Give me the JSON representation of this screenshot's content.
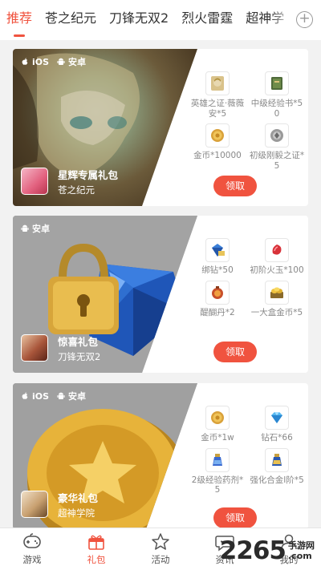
{
  "tabs": [
    {
      "label": "推荐",
      "active": true
    },
    {
      "label": "苍之纪元",
      "active": false
    },
    {
      "label": "刀锋无双2",
      "active": false
    },
    {
      "label": "烈火雷霆",
      "active": false
    },
    {
      "label": "超神学",
      "active": false
    }
  ],
  "tab_add_icon": "plus-circle-icon",
  "platform_labels": {
    "ios": "iOS",
    "android": "安卓"
  },
  "cards": [
    {
      "platforms": [
        "ios",
        "android"
      ],
      "pack_name": "星辉专属礼包",
      "game_name": "苍之纪元",
      "items": [
        {
          "icon": "hero-certificate-icon",
          "label": "英雄之证·薇薇安*5"
        },
        {
          "icon": "exp-book-icon",
          "label": "中级经验书*50"
        },
        {
          "icon": "gold-coin-icon",
          "label": "金币*10000"
        },
        {
          "icon": "forge-cert-icon",
          "label": "初级刚毅之证*5"
        }
      ],
      "claim_label": "领取"
    },
    {
      "platforms": [
        "android"
      ],
      "pack_name": "惊喜礼包",
      "game_name": "刀锋无双2",
      "items": [
        {
          "icon": "bound-diamond-icon",
          "label": "绑钻*50"
        },
        {
          "icon": "fire-jade-icon",
          "label": "初阶火玉*100"
        },
        {
          "icon": "elixir-icon",
          "label": "醍醐丹*2"
        },
        {
          "icon": "gold-box-icon",
          "label": "一大盒金币*5"
        }
      ],
      "claim_label": "领取"
    },
    {
      "platforms": [
        "ios",
        "android"
      ],
      "pack_name": "豪华礼包",
      "game_name": "超神学院",
      "items": [
        {
          "icon": "gold-coin-icon",
          "label": "金币*1w"
        },
        {
          "icon": "diamond-icon",
          "label": "钻石*66"
        },
        {
          "icon": "exp-potion-icon",
          "label": "2级经验药剂*5"
        },
        {
          "icon": "alloy-icon",
          "label": "强化合金I阶*5"
        }
      ],
      "claim_label": "领取"
    }
  ],
  "bottom_nav": [
    {
      "icon": "gamepad-icon",
      "label": "游戏",
      "active": false
    },
    {
      "icon": "gift-icon",
      "label": "礼包",
      "active": true
    },
    {
      "icon": "star-icon",
      "label": "活动",
      "active": false
    },
    {
      "icon": "chat-bubble-icon",
      "label": "资讯",
      "active": false
    },
    {
      "icon": "user-icon",
      "label": "我的",
      "active": false
    }
  ],
  "watermark": {
    "big": "2265",
    "small_top": "手游网",
    "small_bottom": ".com"
  },
  "colors": {
    "accent": "#f0533f",
    "background": "#f2f2f2"
  }
}
